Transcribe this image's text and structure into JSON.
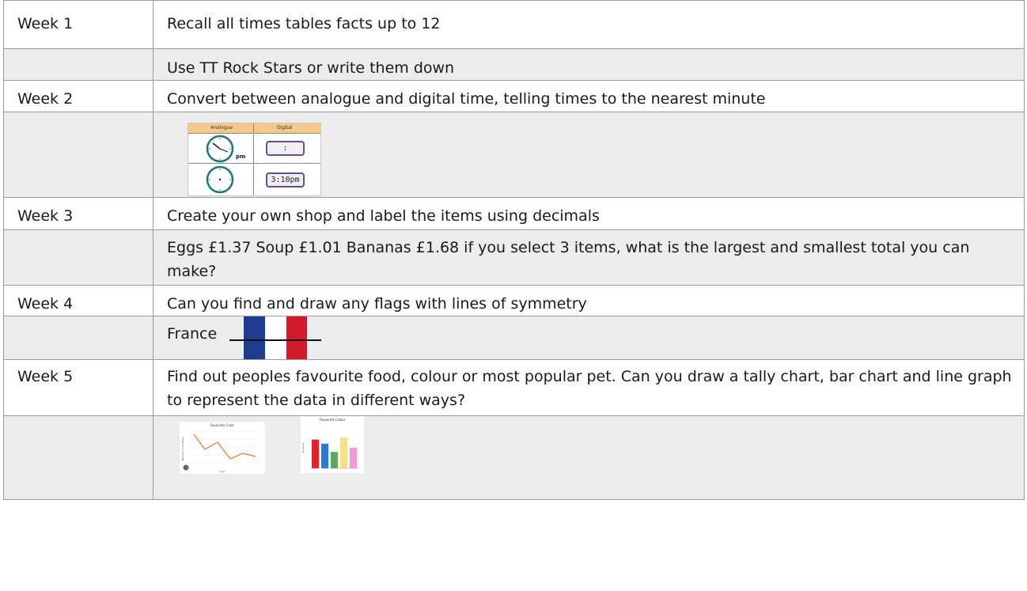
{
  "rows": [
    {
      "week": "Week 1",
      "task": "Recall all times tables facts up to 12"
    },
    {
      "week": "",
      "task": "Use TT Rock Stars or write them down"
    },
    {
      "week": "Week 2",
      "task": "Convert between analogue and digital time, telling times to the nearest minute"
    },
    {
      "week": "Week 3",
      "task": "Create your own shop and label the items using decimals"
    },
    {
      "week": "",
      "task": "Eggs £1.37  Soup £1.01  Bananas £1.68  if you select 3 items, what is the largest and smallest total you can make?"
    },
    {
      "week": "Week 4",
      "task": "Can you find and draw any flags with lines of symmetry"
    },
    {
      "week": "",
      "task": "France"
    },
    {
      "week": "Week 5",
      "task": "Find out peoples favourite food, colour or most popular pet. Can you draw a tally chart, bar chart and line graph to represent the data in different ways?"
    }
  ],
  "clock_table": {
    "header_left": "Analogue",
    "header_right": "Digital",
    "pm_label": "pm",
    "digital_top": ":",
    "digital_bottom": "3:10pm"
  },
  "line_thumb": {
    "title": "Favourite Color",
    "ylabel": "Number of students",
    "xlabel": "Color",
    "accent": "#e07a2b"
  },
  "bar_thumb": {
    "title": "Favourite Colour",
    "ylabel": "Students",
    "colors": [
      "#e8202a",
      "#2b7bd6",
      "#5fa85b",
      "#f7e08a",
      "#f39ad9"
    ]
  }
}
